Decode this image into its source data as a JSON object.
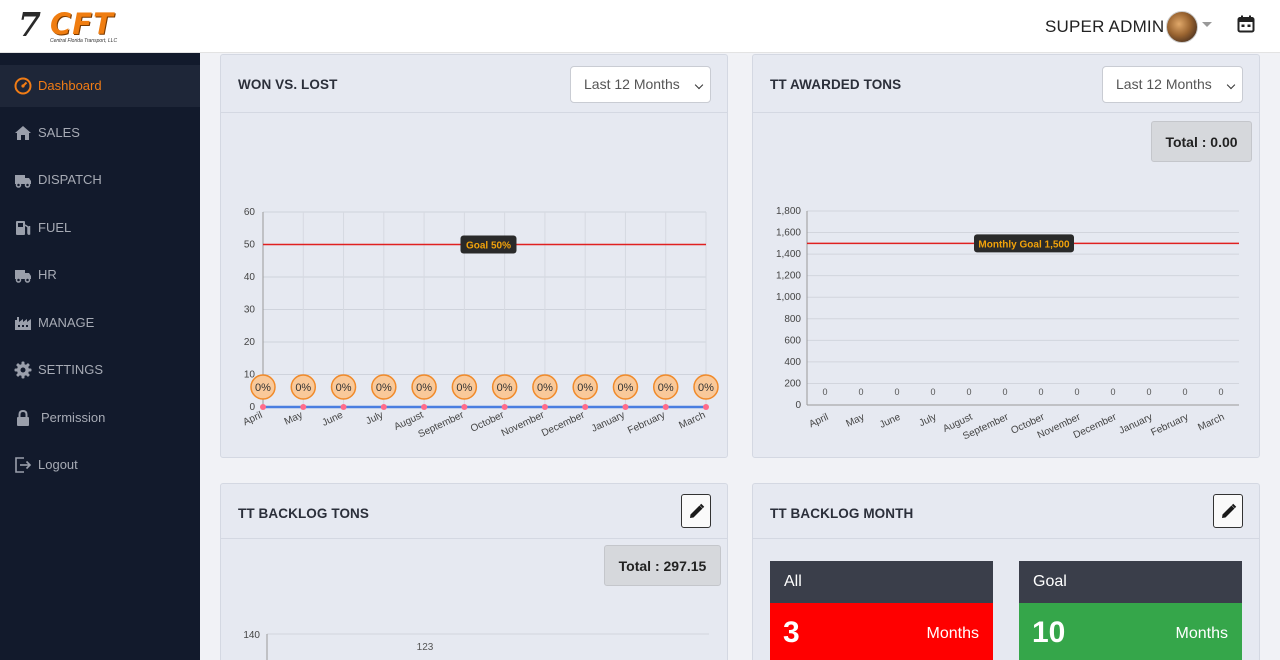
{
  "brand": {
    "logo_mark": "7",
    "logo_letters": "CFT",
    "tagline": "Central Florida Transport, LLC"
  },
  "header": {
    "user_name": "SUPER ADMIN"
  },
  "sidebar": {
    "items": [
      {
        "label": "Dashboard",
        "icon": "gauge-icon",
        "active": true
      },
      {
        "label": "SALES",
        "icon": "home-icon"
      },
      {
        "label": "DISPATCH",
        "icon": "truck-icon"
      },
      {
        "label": "FUEL",
        "icon": "fuel-pump-icon"
      },
      {
        "label": "HR",
        "icon": "truck-icon"
      },
      {
        "label": "MANAGE",
        "icon": "factory-icon"
      },
      {
        "label": "SETTINGS",
        "icon": "gear-icon"
      },
      {
        "label": "Permission",
        "icon": "lock-icon"
      },
      {
        "label": "Logout",
        "icon": "logout-icon"
      }
    ]
  },
  "cards": {
    "won_lost": {
      "title": "WON VS. LOST",
      "period": "Last 12 Months"
    },
    "awarded": {
      "title": "TT AWARDED TONS",
      "period": "Last 12 Months",
      "total": "Total : 0.00"
    },
    "backlog_tons": {
      "title": "TT BACKLOG TONS",
      "total": "Total : 297.15"
    },
    "backlog_month": {
      "title": "TT BACKLOG MONTH",
      "tiles": [
        {
          "label": "All",
          "value": "3",
          "unit": "Months",
          "color": "#ff0000"
        },
        {
          "label": "Goal",
          "value": "10",
          "unit": "Months",
          "color": "#35a64a"
        }
      ]
    }
  },
  "chart_data": [
    {
      "type": "line",
      "categories": [
        "April",
        "May",
        "June",
        "July",
        "August",
        "September",
        "October",
        "November",
        "December",
        "January",
        "February",
        "March"
      ],
      "series": [],
      "values": [
        0,
        0,
        0,
        0,
        0,
        0,
        0,
        0,
        0,
        0,
        0,
        0
      ],
      "point_labels": [
        "0%",
        "0%",
        "0%",
        "0%",
        "0%",
        "0%",
        "0%",
        "0%",
        "0%",
        "0%",
        "0%",
        "0%"
      ],
      "goal": {
        "value": 50,
        "label": "Goal 50%"
      },
      "ylim": [
        0,
        60
      ],
      "yticks": [
        0,
        10,
        20,
        30,
        40,
        50,
        60
      ],
      "grid": true,
      "colors": {
        "line": "#4a7ee0",
        "points": "#ff6b8a",
        "goal": "#e02020",
        "label_fill": "#f9c99a",
        "label_border": "#f08a2a"
      }
    },
    {
      "type": "bar",
      "categories": [
        "April",
        "May",
        "June",
        "July",
        "August",
        "September",
        "October",
        "November",
        "December",
        "January",
        "February",
        "March"
      ],
      "values": [
        0,
        0,
        0,
        0,
        0,
        0,
        0,
        0,
        0,
        0,
        0,
        0
      ],
      "goal": {
        "value": 1500,
        "label": "Monthly Goal 1,500"
      },
      "ylim": [
        0,
        1800
      ],
      "yticks": [
        "0",
        "200",
        "400",
        "600",
        "800",
        "1,000",
        "1,200",
        "1,400",
        "1,600",
        "1,800"
      ],
      "grid": true,
      "colors": {
        "goal": "#e02020",
        "goal_label": "#f2a20a"
      }
    },
    {
      "type": "bar",
      "yticks": [
        "140"
      ],
      "data_labels": [
        "123"
      ]
    }
  ]
}
